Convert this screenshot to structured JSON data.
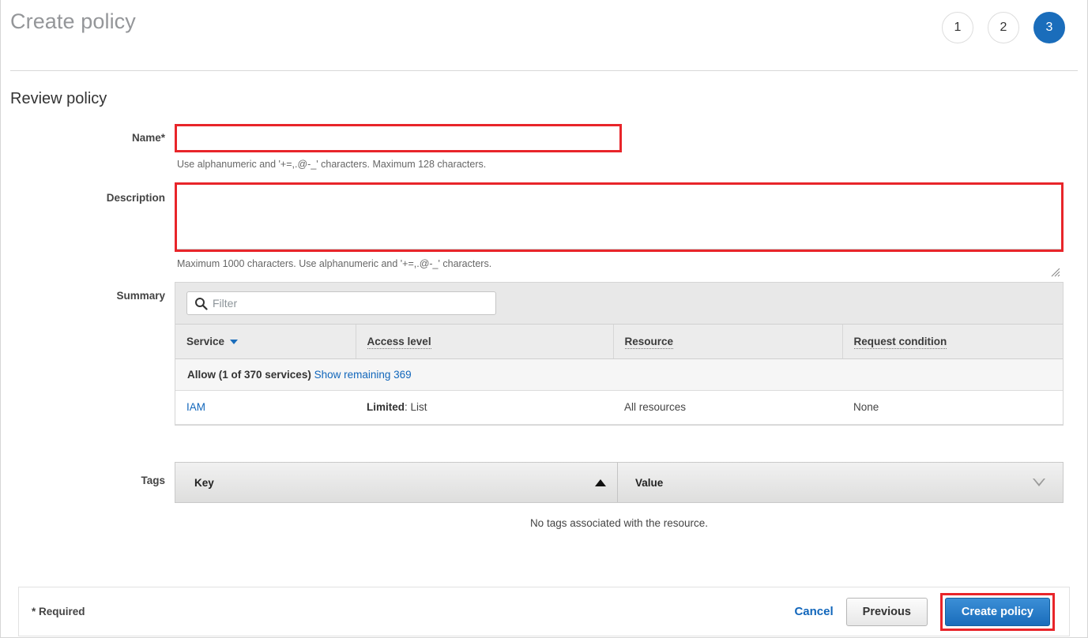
{
  "header": {
    "title": "Create policy",
    "steps": [
      {
        "label": "1",
        "active": false
      },
      {
        "label": "2",
        "active": false
      },
      {
        "label": "3",
        "active": true
      }
    ]
  },
  "review": {
    "section_title": "Review policy",
    "name": {
      "label": "Name*",
      "value": "",
      "placeholder": "",
      "hint": "Use alphanumeric and '+=,.@-_' characters. Maximum 128 characters."
    },
    "description": {
      "label": "Description",
      "value": "",
      "placeholder": "",
      "hint": "Maximum 1000 characters. Use alphanumeric and '+=,.@-_' characters."
    }
  },
  "summary": {
    "label": "Summary",
    "filter": {
      "placeholder": "Filter",
      "value": "",
      "icon": "search-icon"
    },
    "columns": [
      {
        "label": "Service",
        "sort": "sort-descending-icon"
      },
      {
        "label": "Access level",
        "sort": ""
      },
      {
        "label": "Resource",
        "sort": ""
      },
      {
        "label": "Request condition",
        "sort": ""
      }
    ],
    "group_row": {
      "label": "Allow (1 of 370 services)",
      "link": "Show remaining 369"
    },
    "rows": [
      {
        "service": "IAM",
        "access_level_prefix": "Limited",
        "access_level_value": ": List",
        "resource": "All resources",
        "request_condition": "None"
      }
    ]
  },
  "tags": {
    "label": "Tags",
    "columns": [
      {
        "label": "Key",
        "sort": "sort-ascending-icon"
      },
      {
        "label": "Value",
        "sort": "sort-down-outline-icon"
      }
    ],
    "empty_message": "No tags associated with the resource."
  },
  "footer": {
    "required_note": "* Required",
    "cancel_label": "Cancel",
    "previous_label": "Previous",
    "create_label": "Create policy"
  },
  "colors": {
    "accent_blue": "#1a6dbb",
    "link_blue": "#1166bb",
    "annotation_red": "#e8252a",
    "title_gray": "#949699"
  }
}
